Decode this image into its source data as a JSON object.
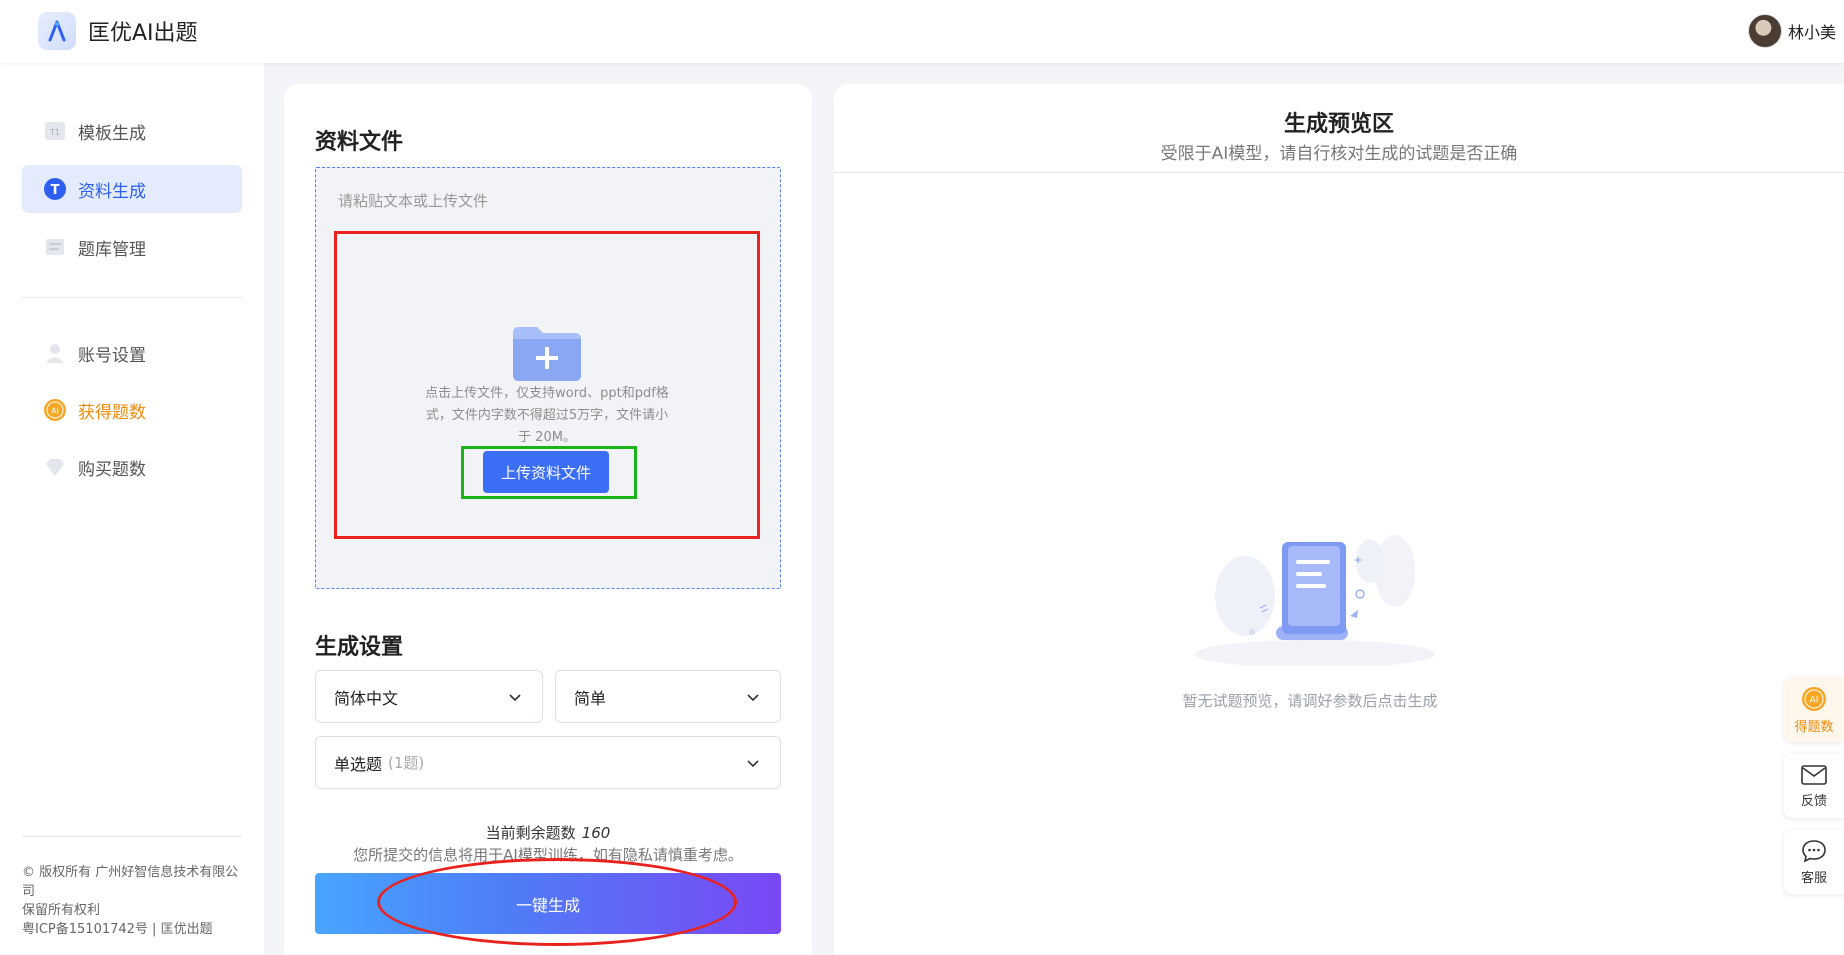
{
  "header": {
    "app_title": "匡优AI出题",
    "user_name": "林小美"
  },
  "sidebar": {
    "items": [
      {
        "label": "模板生成",
        "icon": "template-icon",
        "active": false
      },
      {
        "label": "资料生成",
        "icon": "material-icon",
        "active": true
      },
      {
        "label": "题库管理",
        "icon": "question-bank-icon",
        "active": false
      },
      {
        "label": "账号设置",
        "icon": "user-icon",
        "active": false
      },
      {
        "label": "获得题数",
        "icon": "ai-coin-icon",
        "active": false
      },
      {
        "label": "购买题数",
        "icon": "diamond-icon",
        "active": false
      }
    ],
    "footer_lines": [
      "© 版权所有 广州好智信息技术有限公司",
      "保留所有权利",
      "粤ICP备15101742号 | 匡优出题"
    ]
  },
  "material": {
    "title": "资料文件",
    "paste_placeholder": "请粘贴文本或上传文件",
    "upload_description": "点击上传文件，仅支持word、ppt和pdf格式，文件内字数不得超过5万字，文件请小于 20M。",
    "upload_button": "上传资料文件"
  },
  "settings": {
    "title": "生成设置",
    "language": "简体中文",
    "difficulty": "简单",
    "question_type": "单选题",
    "question_count": "(1题)"
  },
  "footer_actions": {
    "quota_label": "当前剩余题数",
    "quota_value": "160",
    "privacy_note": "您所提交的信息将用于AI模型训练，如有隐私请慎重考虑。",
    "generate_button": "一键生成"
  },
  "preview": {
    "title": "生成预览区",
    "subtitle": "受限于AI模型，请自行核对生成的试题是否正确",
    "empty_text": "暂无试题预览，请调好参数后点击生成"
  },
  "floating_toolbar": [
    {
      "label": "得题数",
      "icon": "ai-coin-icon"
    },
    {
      "label": "反馈",
      "icon": "mail-icon"
    },
    {
      "label": "客服",
      "icon": "chat-icon"
    }
  ],
  "colors": {
    "accent": "#3b6ef5",
    "active_nav_bg": "#e3ebfd",
    "points_orange": "#f08b0c",
    "annotation_red": "#e8231f",
    "annotation_green": "#18b418"
  }
}
